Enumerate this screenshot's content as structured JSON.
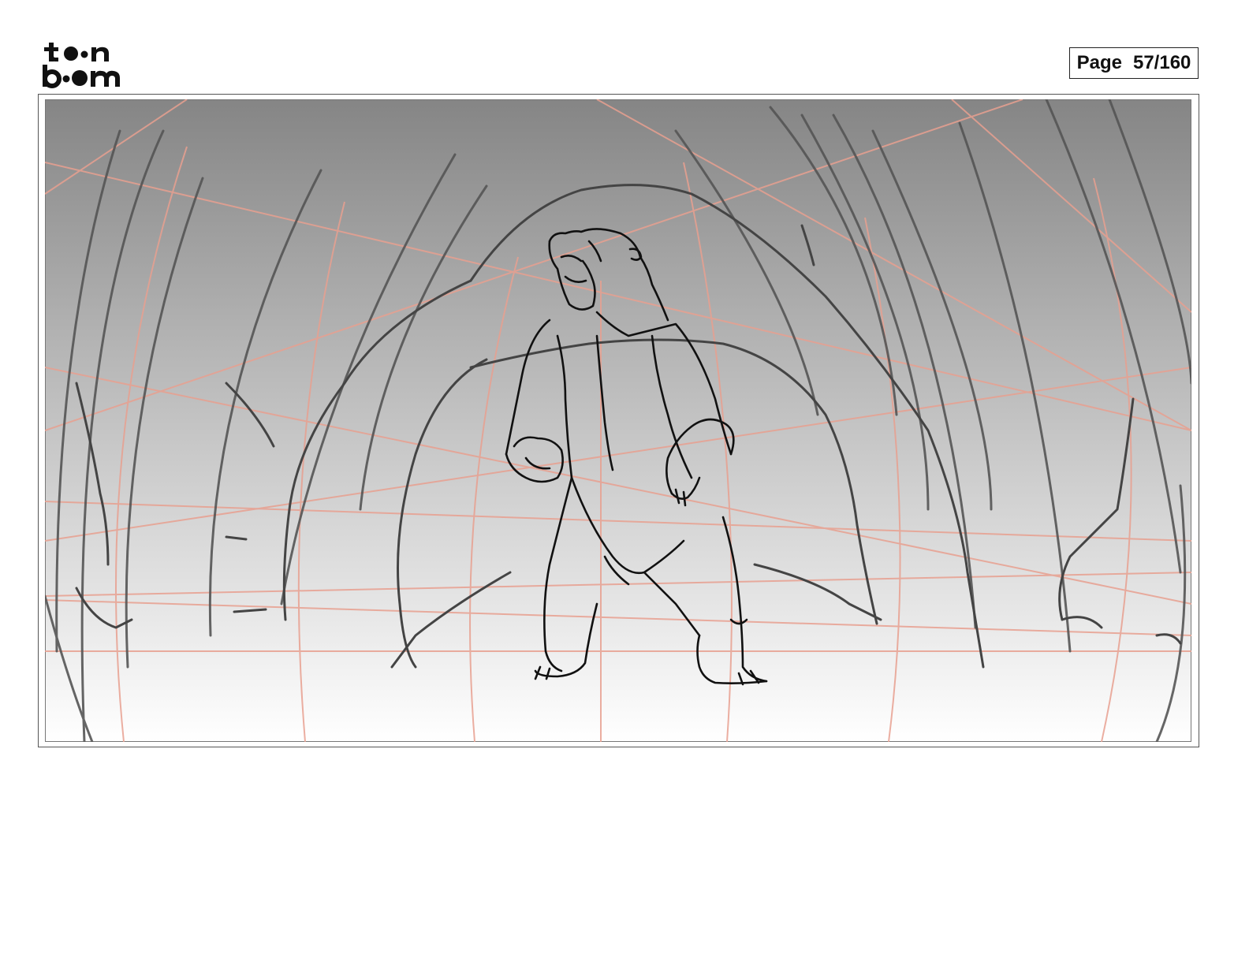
{
  "header": {
    "logo_icon": "toon-boom-logo-icon",
    "page_label": "Page",
    "page_number": "57/160"
  },
  "panel": {
    "image_icon": "bear-standing-in-cave-sketch-icon",
    "colors": {
      "gradient_top": "#858585",
      "gradient_bottom": "#ffffff",
      "perspective_guides": "#e8a090",
      "sketch_line": "#111111"
    }
  }
}
